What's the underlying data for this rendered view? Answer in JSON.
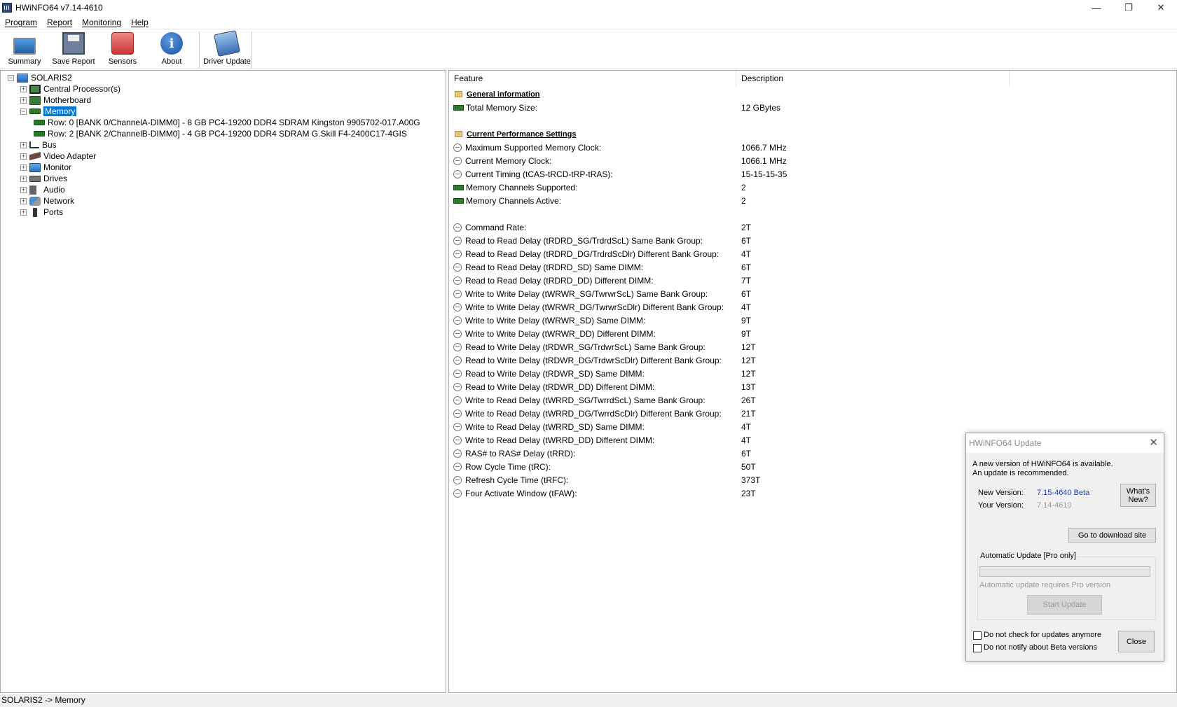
{
  "window": {
    "title": "HWiNFO64 v7.14-4610",
    "minimize": "—",
    "restore": "❐",
    "close": "✕"
  },
  "menu": [
    "Program",
    "Report",
    "Monitoring",
    "Help"
  ],
  "toolbar": {
    "summary": "Summary",
    "save_report": "Save Report",
    "sensors": "Sensors",
    "about": "About",
    "driver_update": "Driver Update",
    "about_glyph": "i"
  },
  "tree": {
    "root": "SOLARIS2",
    "cpu": "Central Processor(s)",
    "motherboard": "Motherboard",
    "memory": "Memory",
    "memory_rows": [
      "Row: 0 [BANK 0/ChannelA-DIMM0] - 8 GB PC4-19200 DDR4 SDRAM Kingston 9905702-017.A00G",
      "Row: 2 [BANK 2/ChannelB-DIMM0] - 4 GB PC4-19200 DDR4 SDRAM G.Skill F4-2400C17-4GIS"
    ],
    "bus": "Bus",
    "video": "Video Adapter",
    "monitor": "Monitor",
    "drives": "Drives",
    "audio": "Audio",
    "network": "Network",
    "ports": "Ports",
    "plus": "+",
    "minus": "−"
  },
  "columns": {
    "feature": "Feature",
    "description": "Description"
  },
  "details": {
    "general_info": "General information",
    "total_memory_label": "Total Memory Size:",
    "total_memory_value": "12 GBytes",
    "perf_settings": "Current Performance Settings",
    "perf": [
      {
        "icon": "gauge",
        "label": "Maximum Supported Memory Clock:",
        "value": "1066.7 MHz"
      },
      {
        "icon": "gauge",
        "label": "Current Memory Clock:",
        "value": "1066.1 MHz"
      },
      {
        "icon": "gauge",
        "label": "Current Timing (tCAS-tRCD-tRP-tRAS):",
        "value": "15-15-15-35"
      },
      {
        "icon": "memory",
        "label": "Memory Channels Supported:",
        "value": "2"
      },
      {
        "icon": "memory",
        "label": "Memory Channels Active:",
        "value": "2"
      }
    ],
    "timings": [
      {
        "label": "Command Rate:",
        "value": "2T"
      },
      {
        "label": "Read to Read Delay (tRDRD_SG/TrdrdScL) Same Bank Group:",
        "value": "6T"
      },
      {
        "label": "Read to Read Delay (tRDRD_DG/TrdrdScDlr) Different Bank Group:",
        "value": "4T"
      },
      {
        "label": "Read to Read Delay (tRDRD_SD) Same DIMM:",
        "value": "6T"
      },
      {
        "label": "Read to Read Delay (tRDRD_DD) Different DIMM:",
        "value": "7T"
      },
      {
        "label": "Write to Write Delay (tWRWR_SG/TwrwrScL) Same Bank Group:",
        "value": "6T"
      },
      {
        "label": "Write to Write Delay (tWRWR_DG/TwrwrScDlr) Different Bank Group:",
        "value": "4T"
      },
      {
        "label": "Write to Write Delay (tWRWR_SD) Same DIMM:",
        "value": "9T"
      },
      {
        "label": "Write to Write Delay (tWRWR_DD) Different DIMM:",
        "value": "9T"
      },
      {
        "label": "Read to Write Delay (tRDWR_SG/TrdwrScL) Same Bank Group:",
        "value": "12T"
      },
      {
        "label": "Read to Write Delay (tRDWR_DG/TrdwrScDlr) Different Bank Group:",
        "value": "12T"
      },
      {
        "label": "Read to Write Delay (tRDWR_SD) Same DIMM:",
        "value": "12T"
      },
      {
        "label": "Read to Write Delay (tRDWR_DD) Different DIMM:",
        "value": "13T"
      },
      {
        "label": "Write to Read Delay (tWRRD_SG/TwrrdScL) Same Bank Group:",
        "value": "26T"
      },
      {
        "label": "Write to Read Delay (tWRRD_DG/TwrrdScDlr) Different Bank Group:",
        "value": "21T"
      },
      {
        "label": "Write to Read Delay (tWRRD_SD) Same DIMM:",
        "value": "4T"
      },
      {
        "label": "Write to Read Delay (tWRRD_DD) Different DIMM:",
        "value": "4T"
      },
      {
        "label": "RAS# to RAS# Delay (tRRD):",
        "value": "6T"
      },
      {
        "label": "Row Cycle Time (tRC):",
        "value": "50T"
      },
      {
        "label": "Refresh Cycle Time (tRFC):",
        "value": "373T"
      },
      {
        "label": "Four Activate Window (tFAW):",
        "value": "23T"
      }
    ]
  },
  "status_bar": "SOLARIS2 -> Memory",
  "update_dialog": {
    "title": "HWiNFO64 Update",
    "close_glyph": "✕",
    "message_line1": "A new version of HWiNFO64 is available.",
    "message_line2": "An update is recommended.",
    "new_version_label": "New Version:",
    "new_version_value": "7.15-4640 Beta",
    "your_version_label": "Your Version:",
    "your_version_value": "7.14-4610",
    "whats_new_line1": "What's",
    "whats_new_line2": "New?",
    "download_button": "Go to download site",
    "auto_update_group": "Automatic Update [Pro only]",
    "auto_update_note": "Automatic update requires Pro version",
    "start_update_button": "Start Update",
    "check_no_updates": "Do not check for updates anymore",
    "check_no_beta": "Do not notify about Beta versions",
    "close_button": "Close",
    "accent_color": "#1f3fa8",
    "disabled_color": "#9a9a9a"
  }
}
